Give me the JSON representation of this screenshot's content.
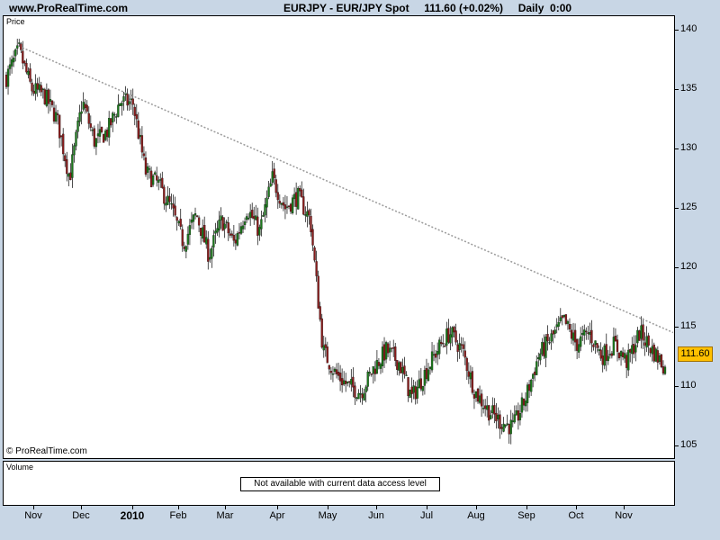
{
  "site": {
    "name": "www.ProRealTime.com"
  },
  "header": {
    "symbol": "EURJPY - EUR/JPY Spot",
    "last": "111.60 (+0.02%)",
    "period": "Daily  0:00"
  },
  "panels": {
    "price_label": "Price",
    "volume_label": "Volume",
    "volume_message": "Not available with current data access level",
    "copyright": "© ProRealTime.com"
  },
  "price_tag": "111.60",
  "chart_data": {
    "type": "candlestick",
    "ylim": [
      104,
      141
    ],
    "yticks": [
      "140",
      "135",
      "130",
      "125",
      "120",
      "115",
      "110",
      "105"
    ],
    "xticks": [
      "Nov",
      "Dec",
      "2010",
      "Feb",
      "Mar",
      "Apr",
      "May",
      "Jun",
      "Jul",
      "Aug",
      "Sep",
      "Oct",
      "Nov"
    ],
    "path": [
      136.0,
      138.3,
      135.0,
      134.5,
      132.5,
      127.5,
      134.0,
      130.5,
      131.5,
      134.0,
      133.8,
      128.0,
      127.0,
      125.0,
      122.0,
      124.5,
      121.0,
      124.0,
      122.0,
      125.0,
      123.0,
      127.5,
      125.0,
      126.0,
      124.0,
      113.0,
      111.0,
      110.0,
      109.5,
      111.5,
      113.0,
      112.0,
      109.0,
      111.0,
      113.0,
      114.5,
      113.0,
      109.5,
      108.0,
      107.0,
      106.5,
      109.0,
      112.5,
      114.0,
      115.5,
      113.5,
      114.5,
      112.5,
      113.5,
      112.0,
      114.5,
      113.0,
      111.6
    ],
    "trendline": {
      "from": 138.5,
      "to": 114.5
    },
    "last_price": 111.6
  },
  "colors": {
    "up": "#1b7a1b",
    "down": "#8a1b1b",
    "trendline": "#9a9a9a",
    "background": "#c8d6e5"
  }
}
